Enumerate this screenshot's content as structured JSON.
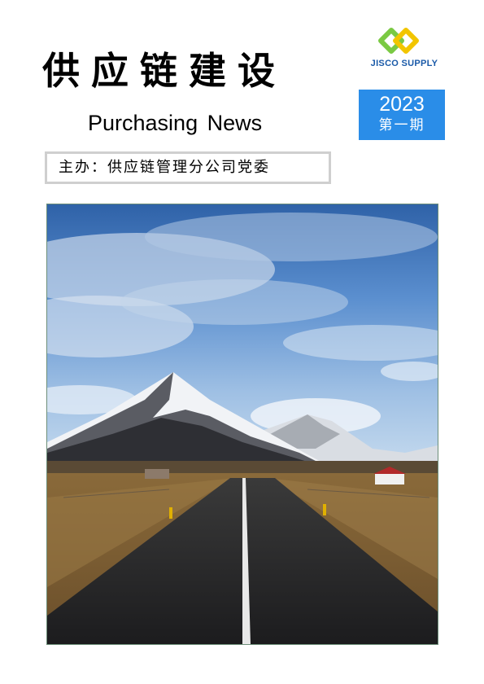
{
  "header": {
    "title": "供应链建设",
    "subtitle": "Purchasing News"
  },
  "logo": {
    "text": "JISCO SUPPLY",
    "colors": {
      "green": "#7ac943",
      "yellow": "#f2c500",
      "blue": "#1a5aa8"
    }
  },
  "issue": {
    "year": "2023",
    "number": "第一期",
    "background": "#2a8de8"
  },
  "sponsor": {
    "text": "主办：供应链管理分公司党委"
  },
  "cover_photo": {
    "subject": "mountain-road-landscape"
  }
}
